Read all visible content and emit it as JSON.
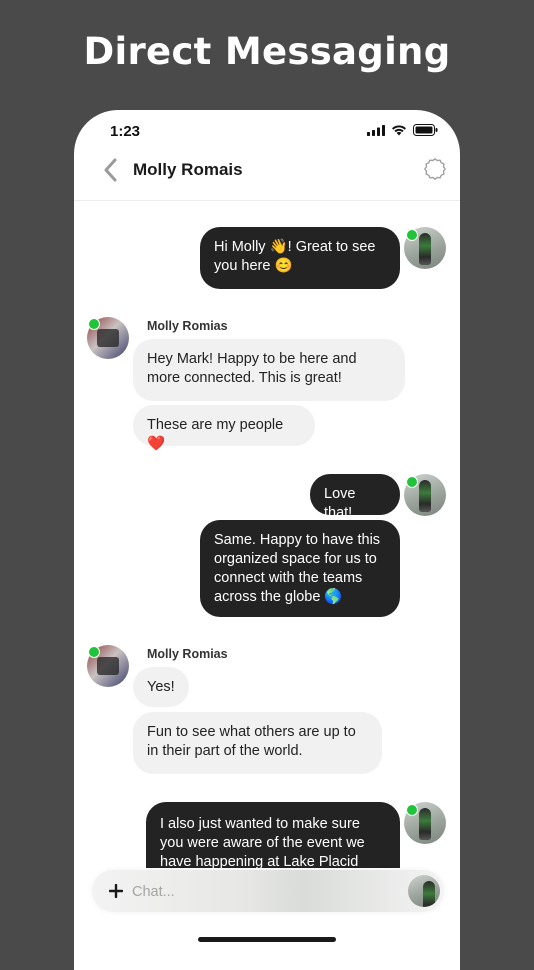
{
  "headline": "Direct Messaging",
  "status_bar": {
    "time": "1:23"
  },
  "nav": {
    "title": "Molly Romais"
  },
  "messages": {
    "m1": "Hi Molly 👋! Great to see you here 😊",
    "group1_sender": "Molly Romias",
    "m2": "Hey Mark! Happy to be here and more connected. This is great!",
    "m3": "These are my people ❤️",
    "m4": "Love that!",
    "m5": "Same. Happy to have this organized space for us to connect with the teams across the globe 🌎",
    "group2_sender": "Molly Romias",
    "m6": "Yes!",
    "m7": "Fun to see what others are up to in their part of the world.",
    "m8": "I also just wanted to make sure you were aware of the event we have happening at Lake Placid that we"
  },
  "composer": {
    "placeholder": "Chat..."
  },
  "colors": {
    "background": "#4a4a4a",
    "outgoing_bubble": "#232323",
    "incoming_bubble": "#f1f1f2",
    "online": "#1fc43a"
  },
  "icons": [
    "back-chevron-icon",
    "settings-gear-icon",
    "signal-icon",
    "wifi-icon",
    "battery-icon",
    "plus-icon"
  ]
}
